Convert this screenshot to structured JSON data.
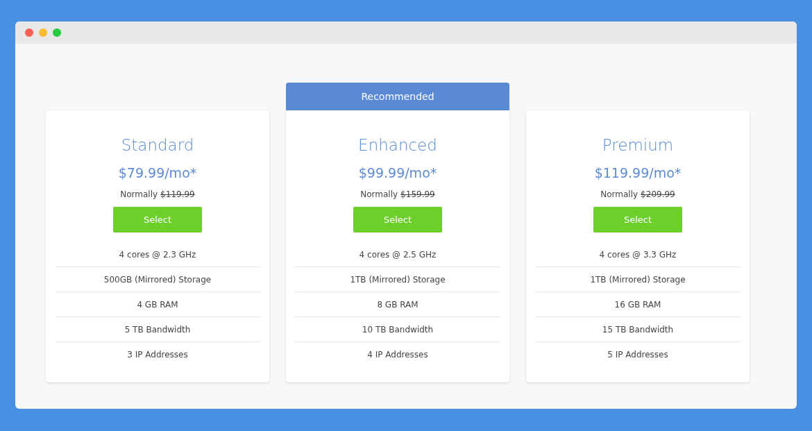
{
  "plans": [
    {
      "name": "Standard",
      "price": "$79.99/mo*",
      "normally_label": "Normally",
      "normal_price": "$119.99",
      "button": "Select",
      "features": [
        "4 cores @ 2.3 GHz",
        "500GB (Mirrored) Storage",
        "4 GB RAM",
        "5 TB Bandwidth",
        "3 IP Addresses"
      ]
    },
    {
      "badge": "Recommended",
      "name": "Enhanced",
      "price": "$99.99/mo*",
      "normally_label": "Normally",
      "normal_price": "$159.99",
      "button": "Select",
      "features": [
        "4 cores @ 2.5 GHz",
        "1TB (Mirrored) Storage",
        "8 GB RAM",
        "10 TB Bandwidth",
        "4 IP Addresses"
      ]
    },
    {
      "name": "Premium",
      "price": "$119.99/mo*",
      "normally_label": "Normally",
      "normal_price": "$209.99",
      "button": "Select",
      "features": [
        "4 cores @ 3.3 GHz",
        "1TB (Mirrored) Storage",
        "16 GB RAM",
        "15 TB Bandwidth",
        "5 IP Addresses"
      ]
    }
  ]
}
